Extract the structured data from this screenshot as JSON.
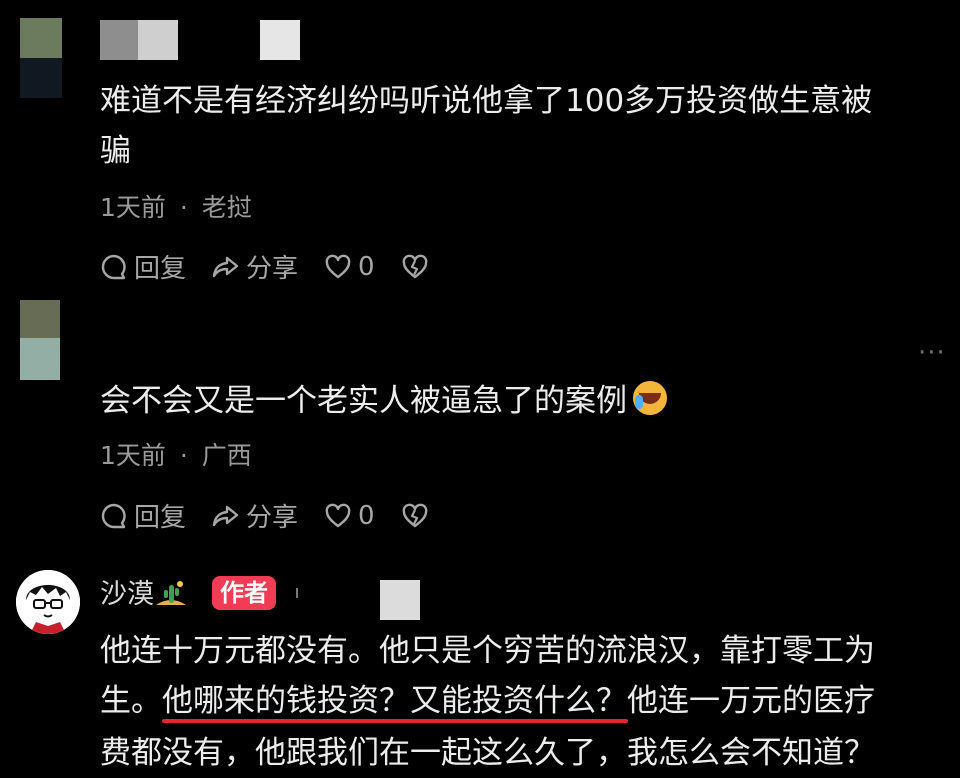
{
  "comments": [
    {
      "text_line1": "难道不是有经济纠纷吗听说他拿了100多万投资做生意被",
      "text_line2": "骗",
      "time": "1天前",
      "location": "老挝",
      "reply_label": "回复",
      "share_label": "分享",
      "likes": "0"
    },
    {
      "text_line1": "会不会又是一个老实人被逼急了的案例",
      "emoji_icon": "crying-laughing-emoji",
      "time": "1天前",
      "location": "广西",
      "reply_label": "回复",
      "share_label": "分享",
      "likes": "0",
      "more_label": "···"
    }
  ],
  "author_comment": {
    "name": "沙漠",
    "badge": "作者",
    "line1": "他连十万元都没有。他只是个穷苦的流浪汉，靠打零工为",
    "line2_pre": "生。",
    "line2_highlight": "他哪来的钱投资？又能投资什么？",
    "line2_post": "他连一万元的医疗",
    "line3": "费都没有，他跟我们在一起这么久了，我怎么会不知道？",
    "highlight_color": "#e3262e",
    "badge_color": "#f23c55"
  },
  "separator": "·"
}
